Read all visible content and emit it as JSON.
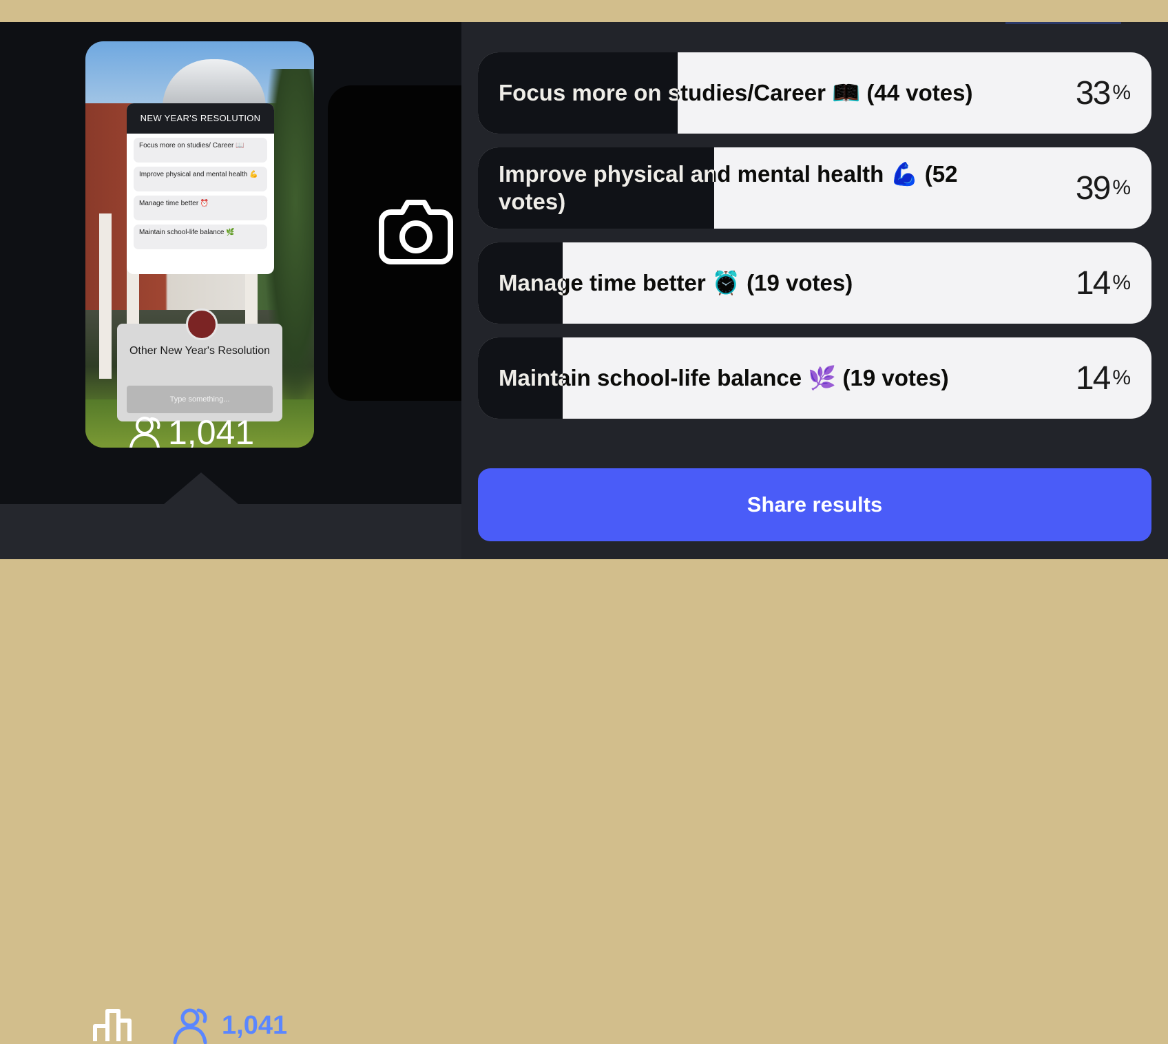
{
  "story": {
    "card_title": "NEW YEAR'S RESOLUTION",
    "mini_options": [
      "Focus more on studies/ Career 📖",
      "Improve physical and mental health 💪",
      "Manage time better ⏰",
      "Maintain school-life balance 🌿"
    ],
    "question_title": "Other New Year's Resolution",
    "question_placeholder": "Type something...",
    "view_count": "1,041"
  },
  "tabs": {
    "viewers_count": "1,041"
  },
  "poll": {
    "options": [
      {
        "label": "Focus more on studies/Career 📖 (44 votes)",
        "percent": 33
      },
      {
        "label": "Improve physical and mental health 💪 (52 votes)",
        "percent": 39
      },
      {
        "label": "Manage time better ⏰ (19 votes)",
        "percent": 14
      },
      {
        "label": "Maintain school-life balance 🌿 (19 votes)",
        "percent": 14
      }
    ],
    "percent_sign": "%",
    "share_label": "Share results"
  },
  "colors": {
    "accent": "#4a5cf8",
    "viewer_accent": "#5a86ff",
    "bar_fill": "#101217",
    "option_bg": "#f3f3f5"
  },
  "icons": [
    "camera-icon",
    "chart-icon",
    "viewers-icon"
  ]
}
